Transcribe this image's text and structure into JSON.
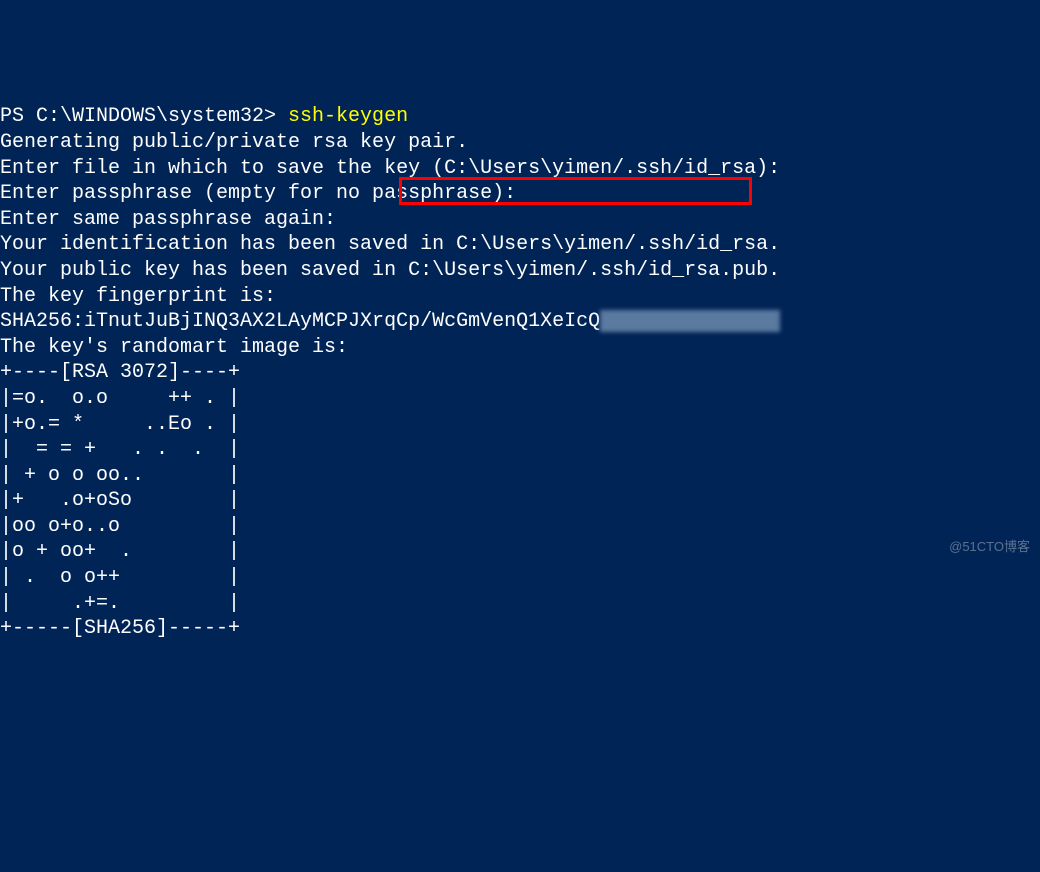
{
  "terminal": {
    "prompt": "PS C:\\WINDOWS\\system32> ",
    "command": "ssh-keygen",
    "lines": [
      "Generating public/private rsa key pair.",
      "Enter file in which to save the key (C:\\Users\\yimen/.ssh/id_rsa):",
      "Enter passphrase (empty for no passphrase):",
      "Enter same passphrase again:",
      "Your identification has been saved in C:\\Users\\yimen/.ssh/id_rsa.",
      "Your public key has been saved in C:\\Users\\yimen/.ssh/id_rsa.pub.",
      "The key fingerprint is:",
      "SHA256:iTnutJuBjINQ3AX2LAyMCPJXrqCp/WcGmVenQ1XeIcQ",
      "The key's randomart image is:",
      "+----[RSA 3072]----+",
      "|=o.  o.o     ++ . |",
      "|+o.= *     ..Eo . |",
      "|  = = +   . .  .  |",
      "| + o o oo..       |",
      "|+   .o+oSo        |",
      "|oo o+o..o         |",
      "|o + oo+  .        |",
      "| .  o o++         |",
      "|     .+=.         |",
      "+-----[SHA256]-----+"
    ],
    "highlighted_path": "C:\\Users\\yimen/.ssh/id_rsa.pub."
  },
  "watermark": "@51CTO博客"
}
